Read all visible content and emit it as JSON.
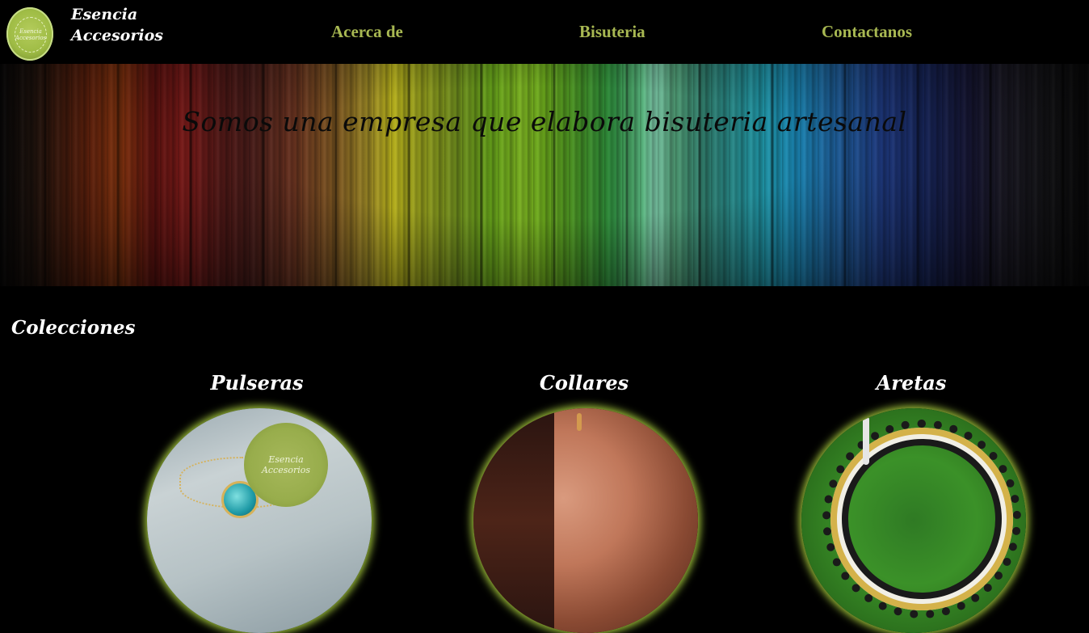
{
  "brand": {
    "line1": "Esencia",
    "line2": "Accesorios",
    "logo_text": "Esencia Accesorios"
  },
  "nav": {
    "items": [
      "Acerca de",
      "Bisuteria",
      "Contactanos"
    ]
  },
  "banner": {
    "tagline": "Somos una empresa que elabora bisuteria artesanal"
  },
  "collections": {
    "title": "Colecciones",
    "items": [
      {
        "label": "Pulseras",
        "stamp_text": "Esencia Accesorios"
      },
      {
        "label": "Collares"
      },
      {
        "label": "Aretas"
      }
    ]
  },
  "colors": {
    "nav_link": "#a8b852",
    "glow": "#9fc23a",
    "background": "#000000"
  }
}
